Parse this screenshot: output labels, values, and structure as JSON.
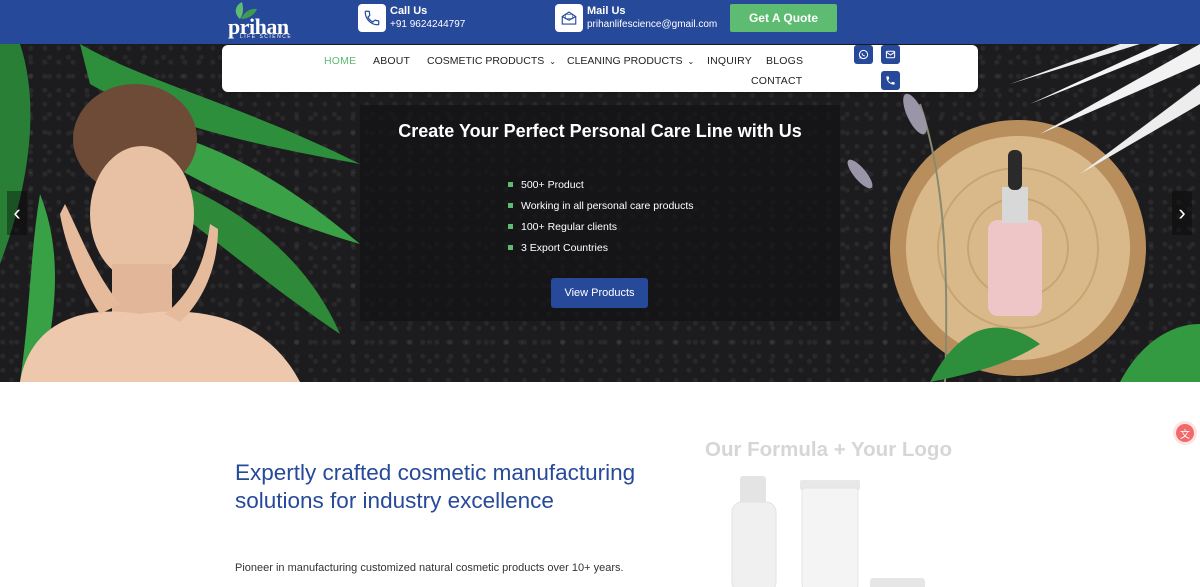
{
  "header": {
    "brand": "prihan",
    "tagline": "LIFE SCIENCE",
    "call": {
      "label": "Call Us",
      "value": "+91 9624244797"
    },
    "mail": {
      "label": "Mail Us",
      "value": "prihanlifescience@gmail.com"
    },
    "quote_button": "Get A Quote"
  },
  "nav": {
    "items": [
      {
        "label": "HOME",
        "active": true
      },
      {
        "label": "ABOUT"
      },
      {
        "label": "COSMETIC PRODUCTS",
        "dropdown": true
      },
      {
        "label": "CLEANING PRODUCTS",
        "dropdown": true
      },
      {
        "label": "INQUIRY"
      },
      {
        "label": "BLOGS"
      },
      {
        "label": "CONTACT"
      }
    ],
    "icons": [
      "whatsapp-icon",
      "mail-icon",
      "phone-icon"
    ]
  },
  "hero": {
    "title": "Create Your Perfect Personal Care Line with Us",
    "bullets": [
      "500+ Product",
      "Working in all personal care products",
      "100+ Regular clients",
      "3 Export Countries"
    ],
    "button": "View Products",
    "prev_arrow": "‹",
    "next_arrow": "›"
  },
  "about": {
    "heading": "Expertly crafted cosmetic manufacturing solutions for industry excellence",
    "description": "Pioneer in manufacturing customized natural cosmetic products over 10+ years."
  },
  "promo": {
    "title": "Our Formula + Your Logo"
  },
  "colors": {
    "primary": "#27499a",
    "accent": "#5dbb72"
  }
}
